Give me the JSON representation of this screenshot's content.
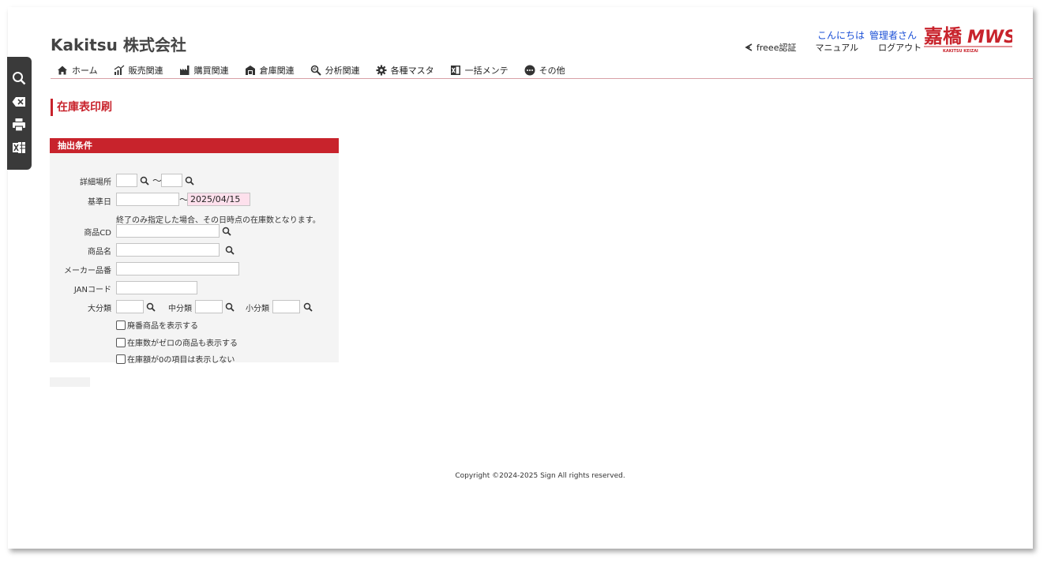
{
  "header": {
    "company": "Kakitsu 株式会社",
    "greeting_prefix": "こんにちは",
    "greeting_user": "管理者さん",
    "links": {
      "freee": "freee認証",
      "manual": "マニュアル",
      "logout": "ログアウト"
    },
    "logo": {
      "kanji": "嘉橋",
      "mws": "MWS",
      "sub": "KAKITSU KEIZAI"
    }
  },
  "nav": [
    {
      "label": "ホーム",
      "icon": "home-icon"
    },
    {
      "label": "販売関連",
      "icon": "chart-up-icon"
    },
    {
      "label": "購買関連",
      "icon": "factory-icon"
    },
    {
      "label": "倉庫関連",
      "icon": "warehouse-icon"
    },
    {
      "label": "分析関連",
      "icon": "analysis-icon"
    },
    {
      "label": "各種マスタ",
      "icon": "gear-icon"
    },
    {
      "label": "一括メンテ",
      "icon": "excel-icon"
    },
    {
      "label": "その他",
      "icon": "more-icon"
    }
  ],
  "page_title": "在庫表印刷",
  "panel": {
    "header": "抽出条件",
    "fields": {
      "location_label": "詳細場所",
      "base_date_label": "基準日",
      "base_date_to": "2025/04/15",
      "tilde": "～",
      "note": "終了のみ指定した場合、その日時点の在庫数となります。",
      "product_cd_label": "商品CD",
      "product_name_label": "商品名",
      "maker_no_label": "メーカー品番",
      "jan_label": "JANコード",
      "large_cat_label": "大分類",
      "mid_cat_label": "中分類",
      "small_cat_label": "小分類"
    },
    "checkboxes": [
      "廃番商品を表示する",
      "在庫数がゼロの商品も表示する",
      "在庫額が0の項目は表示しない"
    ]
  },
  "footer": "Copyright ©2024-2025 Sign All rights reserved.",
  "colors": {
    "accent": "#c8232c",
    "link": "#1a4fd6",
    "sidebar": "#3a3a3a",
    "highlight_input": "#fde0ec"
  }
}
